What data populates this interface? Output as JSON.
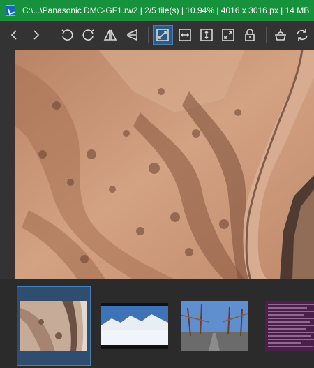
{
  "window": {
    "title": "C:\\...\\Panasonic DMC-GF1.rw2  |  2/5 file(s)  |  10.94%  |  4016 x 3016 px  |  14 MB",
    "icon": "app-logo-icon"
  },
  "toolbar": {
    "buttons": [
      {
        "name": "previous-image",
        "icon": "chevron-left-icon"
      },
      {
        "name": "next-image",
        "icon": "chevron-right-icon"
      },
      {
        "name": "rotate-left",
        "icon": "rotate-left-icon"
      },
      {
        "name": "rotate-right",
        "icon": "rotate-right-icon"
      },
      {
        "name": "flip-horizontal",
        "icon": "flip-horizontal-icon"
      },
      {
        "name": "flip-vertical",
        "icon": "flip-vertical-icon"
      },
      {
        "name": "auto-zoom",
        "icon": "auto-zoom-icon",
        "active": true
      },
      {
        "name": "scale-to-width",
        "icon": "scale-to-width-icon"
      },
      {
        "name": "scale-to-height",
        "icon": "scale-to-height-icon"
      },
      {
        "name": "scale-to-fit",
        "icon": "scale-to-fit-icon"
      },
      {
        "name": "lock-zoom",
        "icon": "lock-icon"
      },
      {
        "name": "checkerboard",
        "icon": "checkerboard-icon"
      },
      {
        "name": "refresh",
        "icon": "refresh-icon"
      }
    ]
  },
  "viewer": {
    "image": "aerial-canyon-photo",
    "accent_color": "#c99778"
  },
  "thumbnails": [
    {
      "name": "thumb-aerial",
      "selected": true
    },
    {
      "name": "thumb-snow-mountains",
      "selected": false
    },
    {
      "name": "thumb-tree-road",
      "selected": false
    },
    {
      "name": "thumb-text-screenshot",
      "selected": false
    }
  ],
  "colors": {
    "titlebar": "#17923c",
    "background": "#333333",
    "selection": "#2f4d6e"
  }
}
